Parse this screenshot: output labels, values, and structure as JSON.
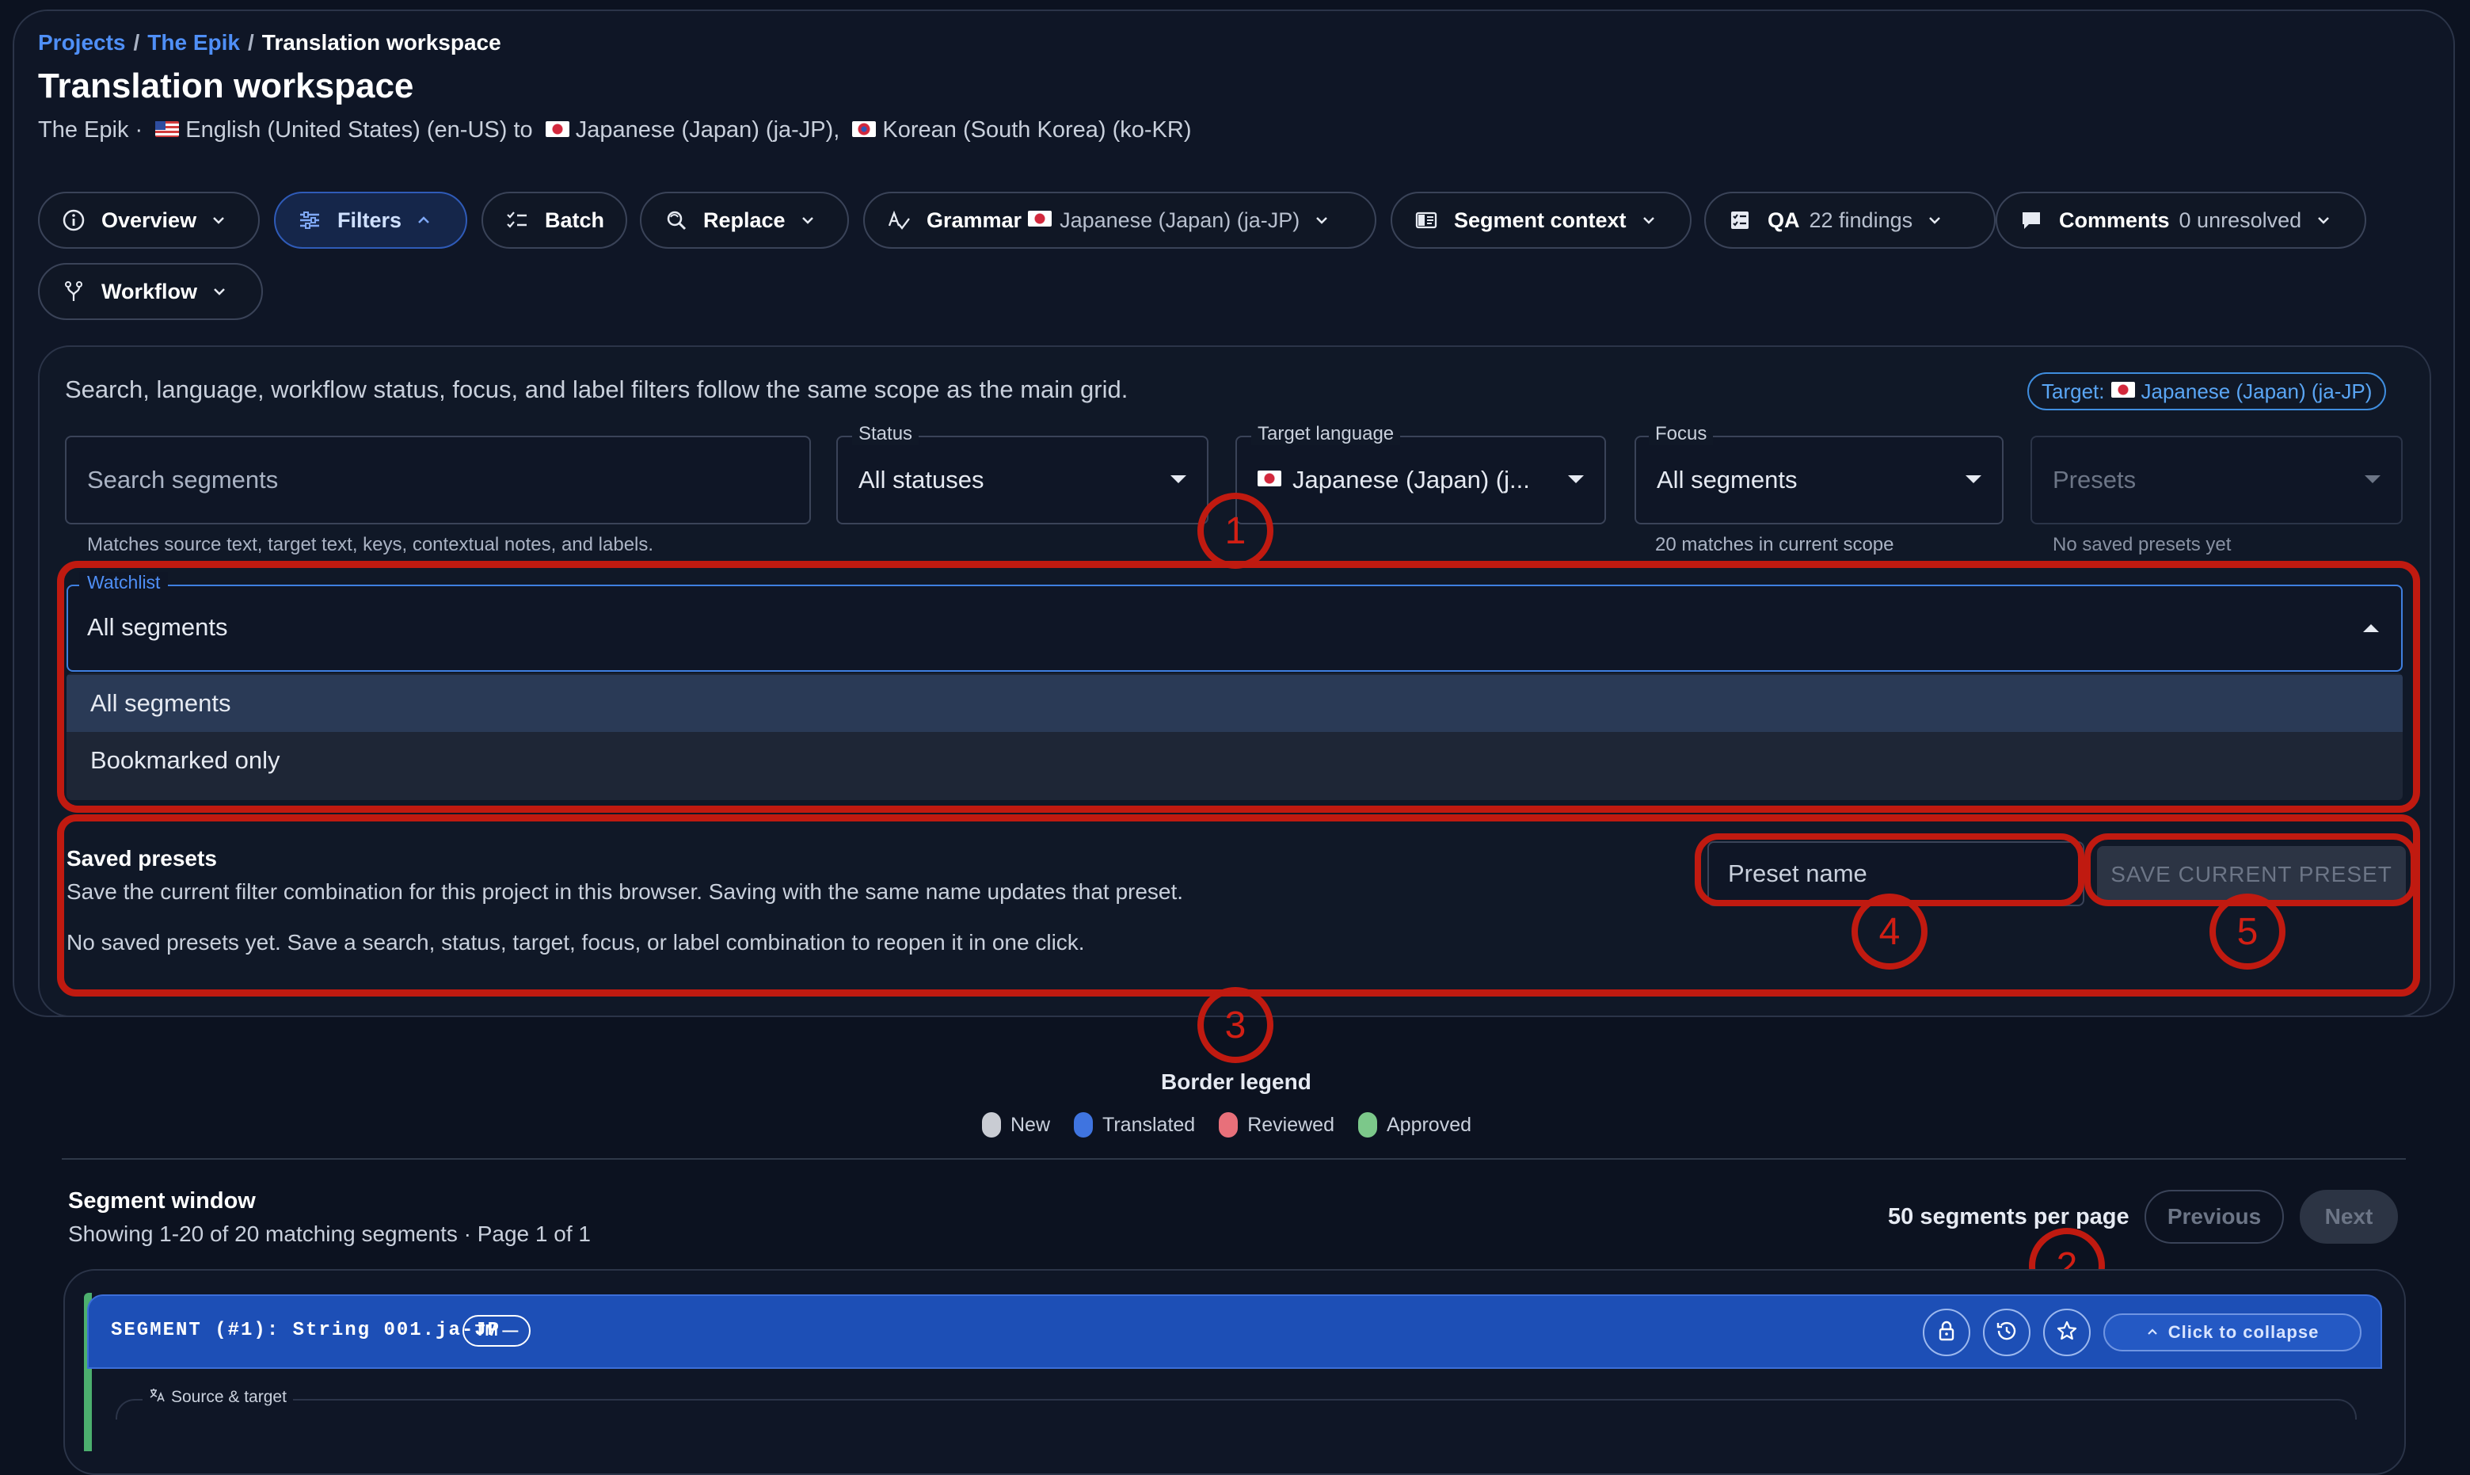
{
  "breadcrumb": {
    "projects": "Projects",
    "project": "The Epik",
    "current": "Translation workspace"
  },
  "header": {
    "title": "Translation workspace",
    "project": "The Epik ·",
    "source_lang": "English (United States) (en-US) to",
    "target_lang_1": "Japanese (Japan) (ja-JP),",
    "target_lang_2": "Korean (South Korea) (ko-KR)"
  },
  "toolbar": {
    "overview": "Overview",
    "filters": "Filters",
    "batch": "Batch",
    "replace": "Replace",
    "grammar": "Grammar",
    "grammar_lang": "Japanese (Japan) (ja-JP)",
    "segment_context": "Segment context",
    "qa": "QA",
    "qa_findings": "22 findings",
    "comments": "Comments",
    "comments_count": "0 unresolved",
    "workflow": "Workflow"
  },
  "filters": {
    "help_text": "Search, language, workflow status, focus, and label filters follow the same scope as the main grid.",
    "target_badge_label": "Target:",
    "target_badge_value": "Japanese (Japan) (ja-JP)",
    "search_placeholder": "Search segments",
    "search_help": "Matches source text, target text, keys, contextual notes, and labels.",
    "status_label": "Status",
    "status_value": "All statuses",
    "target_label": "Target language",
    "target_value": "Japanese (Japan) (j...",
    "focus_label": "Focus",
    "focus_value": "All segments",
    "focus_help": "20 matches in current scope",
    "presets_placeholder": "Presets",
    "presets_help": "No saved presets yet",
    "watchlist_label": "Watchlist",
    "watchlist_value": "All segments",
    "watchlist_options": [
      "All segments",
      "Bookmarked only"
    ]
  },
  "saved_presets": {
    "title": "Saved presets",
    "description": "Save the current filter combination for this project in this browser. Saving with the same name updates that preset.",
    "empty": "No saved presets yet. Save a search, status, target, focus, or label combination to reopen it in one click.",
    "name_placeholder": "Preset name",
    "save_button": "SAVE CURRENT PRESET"
  },
  "annotations": [
    "1",
    "2",
    "3",
    "4",
    "5"
  ],
  "legend": {
    "title": "Border legend",
    "items": [
      {
        "label": "New",
        "color": "#c9ccd3"
      },
      {
        "label": "Translated",
        "color": "#3f74e0"
      },
      {
        "label": "Reviewed",
        "color": "#e8707a"
      },
      {
        "label": "Approved",
        "color": "#7cc88a"
      }
    ]
  },
  "segment_window": {
    "title": "Segment window",
    "subtitle": "Showing 1-20 of 20 matching segments · Page 1 of 1",
    "per_page": "50 segments per page",
    "previous": "Previous",
    "next": "Next"
  },
  "segment": {
    "header": "SEGMENT (#1): String 001.ja-JP",
    "tm_pill": "TM —",
    "collapse": "Click to collapse",
    "source_target": "Source & target"
  },
  "colors": {
    "accent": "#4f8ff7",
    "annotation": "#c01a10",
    "segment_header": "#1d4fb6"
  }
}
